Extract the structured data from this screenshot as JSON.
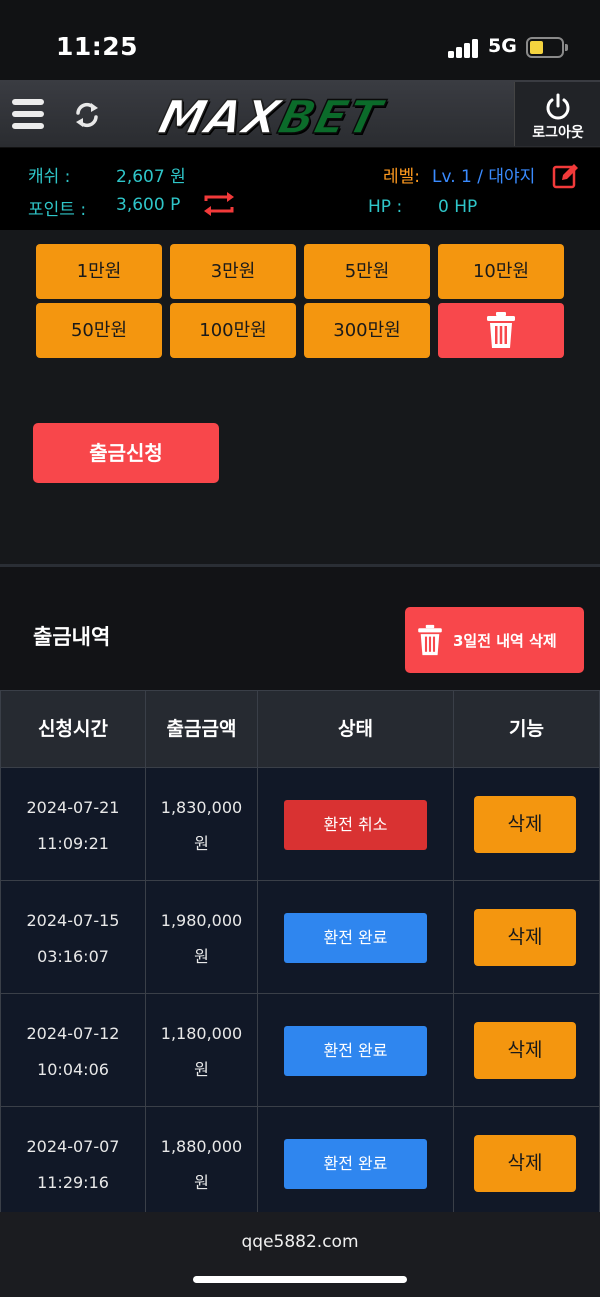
{
  "status_bar": {
    "time": "11:25",
    "network": "5G"
  },
  "header": {
    "logo_max": "MAX",
    "logo_bet": "BET",
    "logout_label": "로그아웃"
  },
  "info": {
    "cash_label": "캐쉬 :",
    "cash_value": "2,607 원",
    "point_label": "포인트 :",
    "point_value": "3,600 P",
    "level_label": "레벨:",
    "level_value": "Lv. 1 / 대야지",
    "hp_label": "HP :",
    "hp_value": "0 HP"
  },
  "amounts": [
    "1만원",
    "3만원",
    "5만원",
    "10만원",
    "50만원",
    "100만원",
    "300만원"
  ],
  "withdraw_button": "출금신청",
  "history": {
    "title": "출금내역",
    "delete_old_label": "3일전 내역 삭제",
    "columns": [
      "신청시간",
      "출금금액",
      "상태",
      "기능"
    ],
    "rows": [
      {
        "date": "2024-07-21",
        "time": "11:09:21",
        "amount": "1,830,000",
        "unit": "원",
        "status": "환전 취소",
        "status_type": "cancel",
        "action": "삭제"
      },
      {
        "date": "2024-07-15",
        "time": "03:16:07",
        "amount": "1,980,000",
        "unit": "원",
        "status": "환전 완료",
        "status_type": "done",
        "action": "삭제"
      },
      {
        "date": "2024-07-12",
        "time": "10:04:06",
        "amount": "1,180,000",
        "unit": "원",
        "status": "환전 완료",
        "status_type": "done",
        "action": "삭제"
      },
      {
        "date": "2024-07-07",
        "time": "11:29:16",
        "amount": "1,880,000",
        "unit": "원",
        "status": "환전 완료",
        "status_type": "done",
        "action": "삭제"
      }
    ]
  },
  "footer": {
    "url": "qqe5882.com"
  },
  "colors": {
    "accent_orange": "#f4960f",
    "accent_red": "#f8474b",
    "status_done": "#2f86ef",
    "status_cancel": "#d93232",
    "teal_text": "#2fc6c9"
  },
  "icons": [
    "menu-icon",
    "refresh-icon",
    "power-icon",
    "transfer-icon",
    "edit-icon",
    "trash-icon"
  ]
}
